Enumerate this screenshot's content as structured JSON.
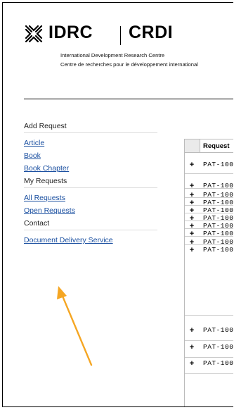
{
  "header": {
    "brand_en": "IDRC",
    "brand_fr": "CRDI",
    "org_name_en": "International Development Research Centre",
    "org_name_fr": "Centre de recherches pour le développement international"
  },
  "sidebar": {
    "add_request": {
      "heading": "Add Request",
      "links": [
        "Article",
        "Book",
        "Book Chapter"
      ]
    },
    "my_requests": {
      "heading": "My Requests",
      "links": [
        "All Requests",
        "Open Requests"
      ]
    },
    "contact": {
      "heading": "Contact",
      "links": [
        "Document Delivery Service"
      ]
    }
  },
  "table": {
    "column_header": "Request",
    "expand_symbol": "+",
    "rows": [
      "PAT-100",
      "PAT-100",
      "PAT-100",
      "PAT-100",
      "PAT-100",
      "PAT-100",
      "PAT-100",
      "PAT-100",
      "PAT-100",
      "PAT-100",
      "PAT-100",
      "PAT-100",
      "PAT-100"
    ]
  },
  "colors": {
    "link": "#1a4fa0",
    "annotation_arrow": "#f5a623"
  }
}
